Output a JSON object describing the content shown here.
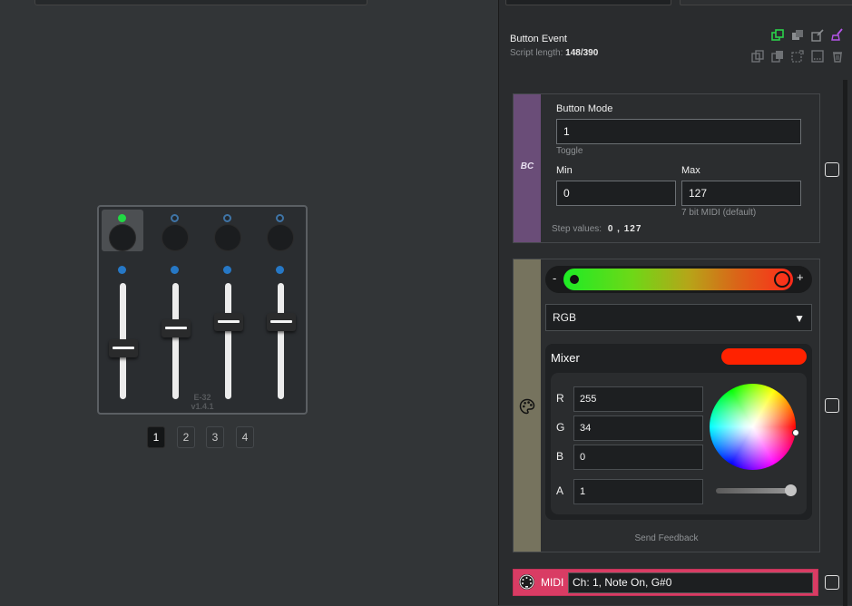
{
  "device": {
    "name_line1": "E-32",
    "name_line2": "v1.4.1",
    "buttons": [
      {
        "led": "on",
        "selected": true
      },
      {
        "led": "off",
        "selected": false
      },
      {
        "led": "off",
        "selected": false
      },
      {
        "led": "off",
        "selected": false
      }
    ],
    "faders": [
      {
        "level": 0.43
      },
      {
        "level": 0.63
      },
      {
        "level": 0.69
      },
      {
        "level": 0.69
      }
    ]
  },
  "pages": [
    "1",
    "2",
    "3",
    "4"
  ],
  "active_page": "1",
  "event": {
    "title": "Button Event",
    "script_length_label": "Script length:",
    "script_length_value": "148/390"
  },
  "toolbar": {
    "row1": [
      "copy-element-icon",
      "paste-element-icon",
      "edit-icon",
      "clear-icon"
    ],
    "row2": [
      "copy-icon",
      "paste-icon",
      "select-icon",
      "merge-icon",
      "delete-icon"
    ]
  },
  "button_mode": {
    "tag": "BC",
    "mode_label": "Button Mode",
    "mode_value": "1",
    "mode_hint": "Toggle",
    "min_label": "Min",
    "min_value": "0",
    "max_label": "Max",
    "max_value": "127",
    "max_hint": "7 bit MIDI (default)",
    "step_label": "Step values:",
    "step_value": "0 , 127"
  },
  "color": {
    "minus": "-",
    "plus": "+",
    "mode": "RGB",
    "mixer_title": "Mixer",
    "swatch": "#ff2200",
    "r_label": "R",
    "r_value": "255",
    "g_label": "G",
    "g_value": "34",
    "b_label": "B",
    "b_value": "0",
    "a_label": "A",
    "a_value": "1",
    "alpha_level": 1,
    "send_feedback": "Send Feedback"
  },
  "midi": {
    "label": "MIDI",
    "value": "Ch: 1, Note On, G#0"
  },
  "colors": {
    "accent_green": "#21d944",
    "midi_pink": "#d93c64",
    "bc_tag": "#6a4d78",
    "color_tag": "#76735e"
  }
}
